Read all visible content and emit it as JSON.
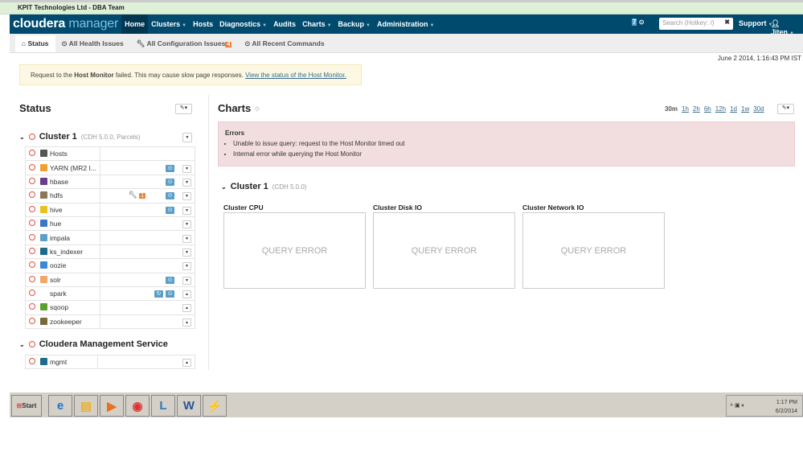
{
  "window_title": "KPIT Technologies Ltd - DBA Team",
  "nav": {
    "logo_a": "cloudera",
    "logo_b": "manager",
    "items": [
      {
        "label": "Home",
        "active": true
      },
      {
        "label": "Clusters",
        "caret": true
      },
      {
        "label": "Hosts"
      },
      {
        "label": "Diagnostics",
        "caret": true
      },
      {
        "label": "Audits"
      },
      {
        "label": "Charts",
        "caret": true
      },
      {
        "label": "Backup",
        "caret": true
      },
      {
        "label": "Administration",
        "caret": true
      }
    ],
    "commands_count": "7",
    "search_placeholder": "Search (Hotkey: /)",
    "support": "Support",
    "user": "Jiten"
  },
  "tabs": [
    {
      "label": "Status",
      "icon": "home-icon"
    },
    {
      "label": "All Health Issues",
      "icon": "health-icon"
    },
    {
      "label": "All Configuration Issues",
      "icon": "wrench-icon",
      "badge": "4"
    },
    {
      "label": "All Recent Commands",
      "icon": "commands-icon"
    }
  ],
  "timestamp": "June 2 2014, 1:16:43 PM IST",
  "alert": {
    "pre": "Request to the ",
    "bold": "Host Monitor",
    "post": " failed. This may cause slow page responses. ",
    "link": "View the status of the Host Monitor."
  },
  "status": {
    "title": "Status",
    "cluster": {
      "name": "Cluster 1",
      "sub": "(CDH 5.0.0, Parcels)"
    },
    "services": [
      {
        "name": "Hosts",
        "color": "#555"
      },
      {
        "name": "YARN (MR2 I...",
        "color": "#f0a030",
        "restart": true
      },
      {
        "name": "hbase",
        "color": "#6a3c8c",
        "restart": true
      },
      {
        "name": "hdfs",
        "color": "#8a7a5a",
        "config": "1",
        "restart": true
      },
      {
        "name": "hive",
        "color": "#e8c020",
        "restart": true
      },
      {
        "name": "hue",
        "color": "#3a78c0"
      },
      {
        "name": "impala",
        "color": "#5aa0c8"
      },
      {
        "name": "ks_indexer",
        "color": "#1f6a8a"
      },
      {
        "name": "oozie",
        "color": "#3a88d8"
      },
      {
        "name": "solr",
        "color": "#f0a868",
        "restart": true
      },
      {
        "name": "spark",
        "color": "",
        "refresh": true,
        "restart": true
      },
      {
        "name": "sqoop",
        "color": "#5aa030"
      },
      {
        "name": "zookeeper",
        "color": "#7a6a3a"
      }
    ],
    "mgmt": {
      "name": "Cloudera Management Service",
      "services": [
        {
          "name": "mgmt",
          "color": "#1f6a8a"
        }
      ]
    }
  },
  "charts": {
    "title": "Charts",
    "ranges": [
      "30m",
      "1h",
      "2h",
      "6h",
      "12h",
      "1d",
      "1w",
      "30d"
    ],
    "active_range": "30m",
    "errors": {
      "title": "Errors",
      "items": [
        "Unable to issue query: request to the Host Monitor timed out",
        "Internal error while querying the Host Monitor"
      ]
    },
    "cluster": {
      "name": "Cluster 1",
      "sub": "(CDH 5.0.0)"
    },
    "panels": [
      {
        "title": "Cluster CPU",
        "msg": "QUERY ERROR"
      },
      {
        "title": "Cluster Disk IO",
        "msg": "QUERY ERROR"
      },
      {
        "title": "Cluster Network IO",
        "msg": "QUERY ERROR"
      }
    ]
  },
  "taskbar": {
    "start": "Start",
    "time": "1:17 PM",
    "date": "6/2/2014",
    "apps": [
      "internet-explorer",
      "explorer",
      "media-player",
      "chrome",
      "lync",
      "word",
      "remote-desktop"
    ]
  }
}
